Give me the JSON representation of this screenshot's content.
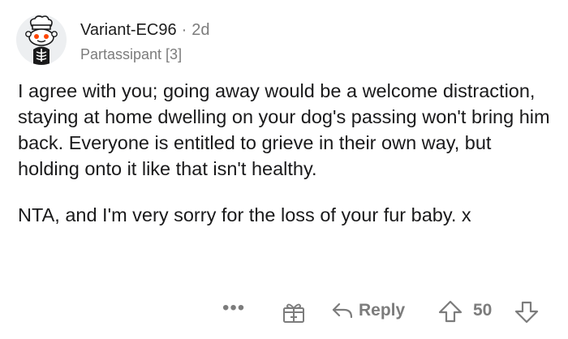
{
  "comment": {
    "author": "Variant-EC96",
    "separator": "·",
    "time_ago": "2d",
    "flair": "Partassipant [3]",
    "paragraphs": [
      "I agree with you; going away would be a welcome distraction, staying at home dwelling on your dog's passing won't bring him back. Everyone is entitled to grieve in their own way, but holding onto it like that isn't healthy.",
      "NTA, and I'm very sorry for the loss of your fur baby. x"
    ]
  },
  "actions": {
    "more_label": "•••",
    "reply_label": "Reply",
    "score": "50",
    "icons": [
      "more-options-icon",
      "award-icon",
      "reply-arrow-icon",
      "upvote-arrow-icon",
      "downvote-arrow-icon"
    ]
  },
  "colors": {
    "text": "#1a1a1b",
    "meta": "#7c7c7c",
    "avatar_bg": "#edeff1",
    "snoo_accent": "#ff4500"
  }
}
